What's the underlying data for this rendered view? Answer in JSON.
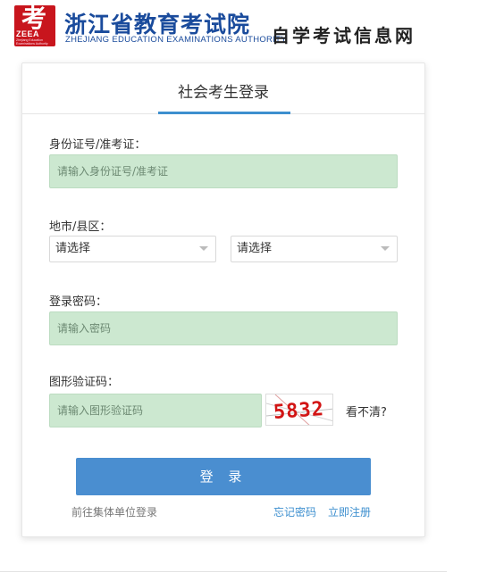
{
  "header": {
    "logo_glyph": "考",
    "logo_abbr": "ZEEA",
    "logo_sub": "Zhejiang Education Examinations Authority",
    "org_name_cn": "浙江省教育考试院",
    "org_name_en": "ZHEJIANG EDUCATION EXAMINATIONS AUTHORITY",
    "site_name": "自学考试信息网"
  },
  "card": {
    "title": "社会考生登录",
    "id_field": {
      "label": "身份证号/准考证：",
      "placeholder": "请输入身份证号/准考证"
    },
    "region": {
      "label": "地市/县区：",
      "city_select": "请选择",
      "district_select": "请选择"
    },
    "password_field": {
      "label": "登录密码：",
      "placeholder": "请输入密码"
    },
    "captcha_field": {
      "label": "图形验证码：",
      "placeholder": "请输入图形验证码",
      "captcha_text": "5832",
      "refresh_label": "看不清?"
    },
    "login_button": "登 录",
    "links": {
      "group_login": "前往集体单位登录",
      "forgot_password": "忘记密码",
      "register": "立即注册"
    }
  },
  "colors": {
    "brand_red": "#c8151d",
    "brand_blue": "#1a4b9c",
    "accent_blue": "#4a8ed0",
    "input_green": "#cce8d0"
  }
}
